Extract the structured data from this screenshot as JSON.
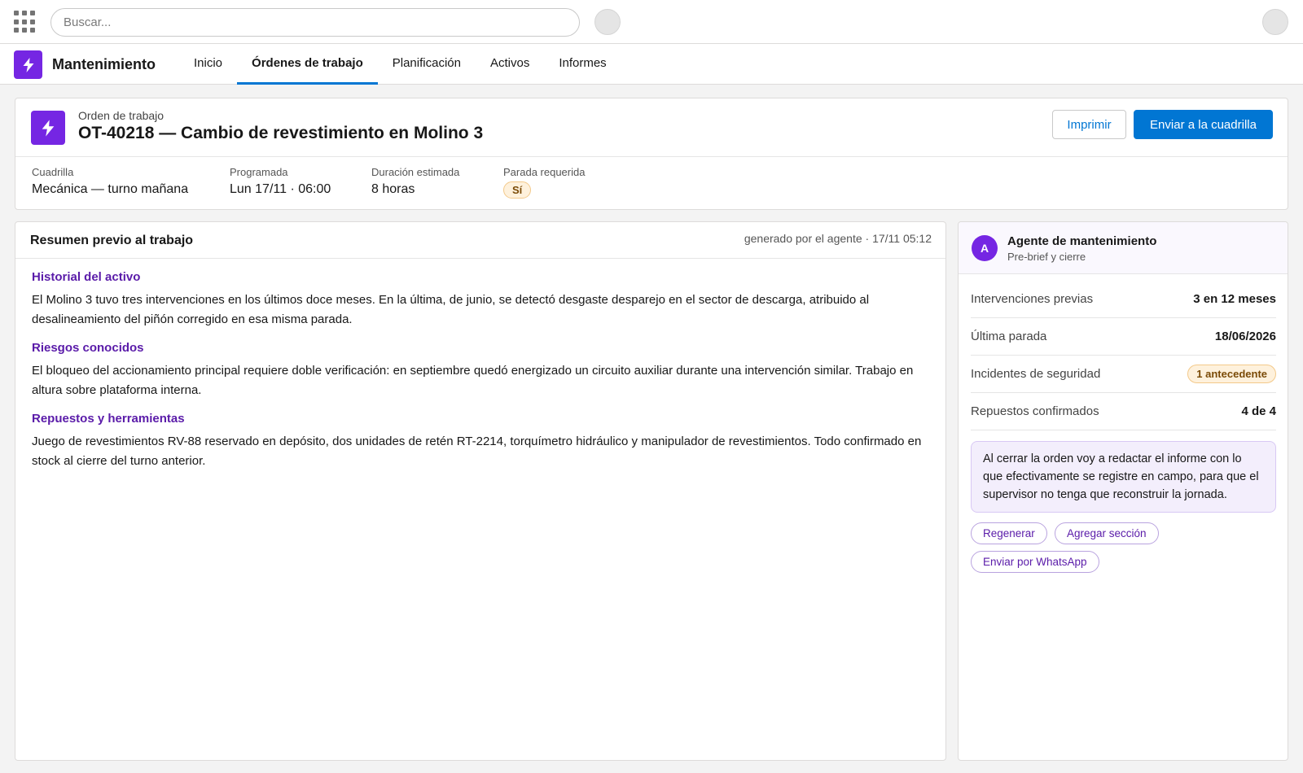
{
  "global_header": {
    "search_placeholder": "Buscar..."
  },
  "app": {
    "name": "Mantenimiento",
    "tabs": [
      {
        "label": "Inicio",
        "active": false
      },
      {
        "label": "Órdenes de trabajo",
        "active": true
      },
      {
        "label": "Planificación",
        "active": false
      },
      {
        "label": "Activos",
        "active": false
      },
      {
        "label": "Informes",
        "active": false
      }
    ]
  },
  "record": {
    "type_label": "Orden de trabajo",
    "title": "OT-40218 — Cambio de revestimiento en Molino 3",
    "print_label": "Imprimir",
    "send_label": "Enviar a la cuadrilla",
    "fields": [
      {
        "label": "Cuadrilla",
        "value": "Mecánica — turno mañana"
      },
      {
        "label": "Programada",
        "value": "Lun 17/11 · 06:00"
      },
      {
        "label": "Duración estimada",
        "value": "8 horas"
      },
      {
        "label": "Parada requerida",
        "value": "Sí"
      }
    ]
  },
  "summary": {
    "title": "Resumen previo al trabajo",
    "meta": "generado por el agente · 17/11 05:12",
    "sections": [
      {
        "heading": "Historial del activo",
        "text": "El Molino 3 tuvo tres intervenciones en los últimos doce meses. En la última, de junio, se detectó desgaste desparejo en el sector de descarga, atribuido al desalineamiento del piñón corregido en esa misma parada."
      },
      {
        "heading": "Riesgos conocidos",
        "text": "El bloqueo del accionamiento principal requiere doble verificación: en septiembre quedó energizado un circuito auxiliar durante una intervención similar. Trabajo en altura sobre plataforma interna."
      },
      {
        "heading": "Repuestos y herramientas",
        "text": "Juego de revestimientos RV-88 reservado en depósito, dos unidades de retén RT-2214, torquímetro hidráulico y manipulador de revestimientos. Todo confirmado en stock al cierre del turno anterior."
      }
    ]
  },
  "agent": {
    "avatar_initial": "A",
    "name": "Agente de mantenimiento",
    "subtitle": "Pre-brief y cierre",
    "stats": [
      {
        "label": "Intervenciones previas",
        "value": "3 en 12 meses"
      },
      {
        "label": "Última parada",
        "value": "18/06/2026"
      },
      {
        "label": "Incidentes de seguridad",
        "value": "1 antecedente"
      },
      {
        "label": "Repuestos confirmados",
        "value": "4 de 4"
      }
    ],
    "note": "Al cerrar la orden voy a redactar el informe con lo que efectivamente se registre en campo, para que el supervisor no tenga que reconstruir la jornada.",
    "actions": {
      "regenerate": "Regenerar",
      "add_section": "Agregar sección",
      "whatsapp": "Enviar por WhatsApp"
    }
  },
  "colors": {
    "brand": "#0176d3",
    "app_accent": "#7526e3",
    "section_heading": "#5a1ba9",
    "warning_bg": "#fef1dc"
  }
}
